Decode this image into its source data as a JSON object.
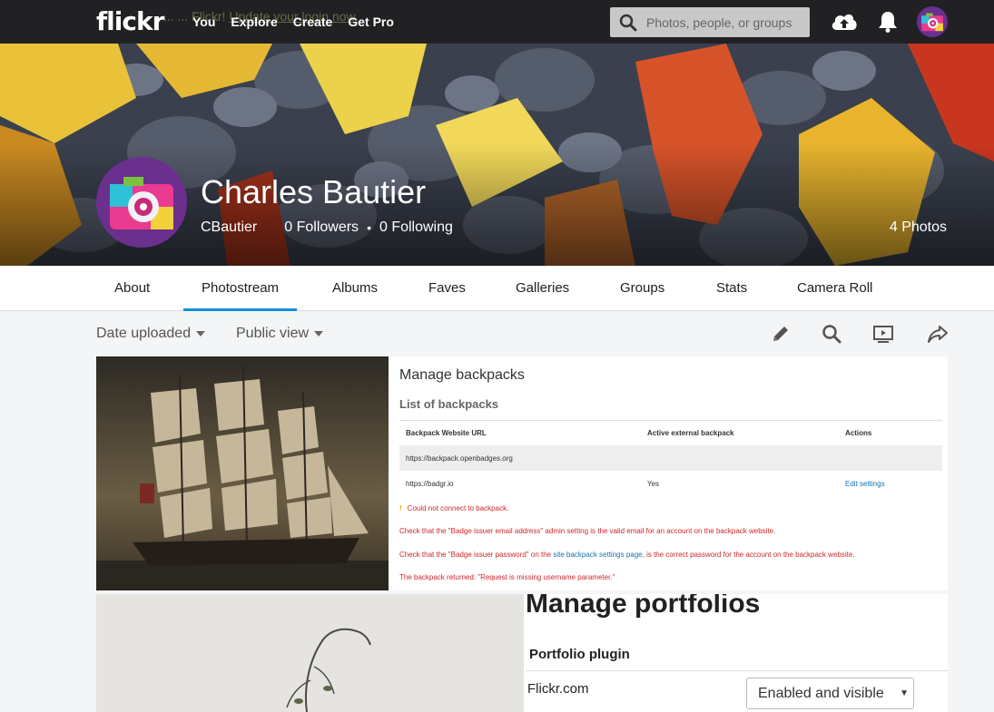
{
  "header": {
    "logo": "flickr",
    "notice_text": "... ... Flickr! ",
    "notice_link": "Update your login now.",
    "nav": [
      "You",
      "Explore",
      "Create",
      "Get Pro"
    ],
    "search_placeholder": "Photos, people, or groups"
  },
  "profile": {
    "name": "Charles Bautier",
    "username": "CBautier",
    "followers": "0 Followers",
    "following": "0 Following",
    "photo_count": "4 Photos"
  },
  "tabs": [
    {
      "label": "About",
      "active": false
    },
    {
      "label": "Photostream",
      "active": true
    },
    {
      "label": "Albums",
      "active": false
    },
    {
      "label": "Faves",
      "active": false
    },
    {
      "label": "Galleries",
      "active": false
    },
    {
      "label": "Groups",
      "active": false
    },
    {
      "label": "Stats",
      "active": false
    },
    {
      "label": "Camera Roll",
      "active": false
    }
  ],
  "toolbar": {
    "sort": "Date uploaded",
    "view": "Public view"
  },
  "backpacks": {
    "title": "Manage backpacks",
    "subtitle": "List of backpacks",
    "headers": [
      "Backpack Website URL",
      "Active external backpack",
      "Actions"
    ],
    "rows": [
      {
        "url": "https://backpack.openbadges.org",
        "active": "",
        "action": ""
      },
      {
        "url": "https://badgr.io",
        "active": "Yes",
        "action": "Edit settings"
      }
    ],
    "errors": [
      "Could not connect to backpack.",
      "Check that the \"Badge issuer email address\" admin setting is the valid email for an account on the backpack website.",
      "Check that the \"Badge issuer password\" on the ",
      "site backpack settings page",
      ", is the correct password for the account on the backpack website.",
      "The backpack returned: \"Request is missing username parameter.\""
    ]
  },
  "portfolios": {
    "title": "Manage portfolios",
    "subtitle": "Portfolio plugin",
    "label": "Flickr.com",
    "select_value": "Enabled and visible"
  },
  "colors": {
    "topbar": "#212124",
    "accent": "#128fdc",
    "error": "#d0262b"
  }
}
